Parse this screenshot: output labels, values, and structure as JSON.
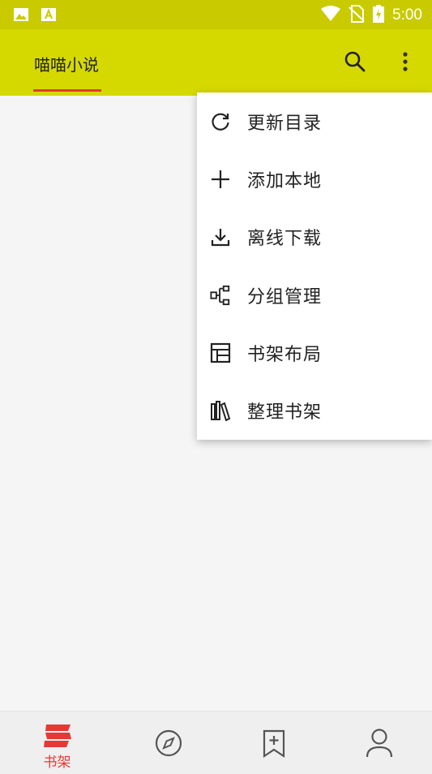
{
  "status_bar": {
    "time": "5:00",
    "icons": [
      "image-notification-icon",
      "a-notification-icon",
      "wifi-icon",
      "no-sim-icon",
      "battery-charging-icon"
    ]
  },
  "app_bar": {
    "tab_label": "喵喵小说",
    "icons": [
      "search-icon",
      "more-vert-icon"
    ]
  },
  "menu": {
    "items": [
      {
        "label": "更新目录",
        "icon": "refresh-icon"
      },
      {
        "label": "添加本地",
        "icon": "plus-icon"
      },
      {
        "label": "离线下载",
        "icon": "download-icon"
      },
      {
        "label": "分组管理",
        "icon": "group-icon"
      },
      {
        "label": "书架布局",
        "icon": "layout-icon"
      },
      {
        "label": "整理书架",
        "icon": "books-icon"
      }
    ]
  },
  "bottom_nav": {
    "items": [
      {
        "label": "书架",
        "icon": "bookshelf-icon",
        "active": true
      },
      {
        "label": "",
        "icon": "compass-icon",
        "active": false
      },
      {
        "label": "",
        "icon": "bookmark-add-icon",
        "active": false
      },
      {
        "label": "",
        "icon": "person-icon",
        "active": false
      }
    ]
  },
  "colors": {
    "status_bar": "#c9cb00",
    "app_bar": "#d6d900",
    "accent": "#e53935",
    "background": "#f5f5f5"
  }
}
